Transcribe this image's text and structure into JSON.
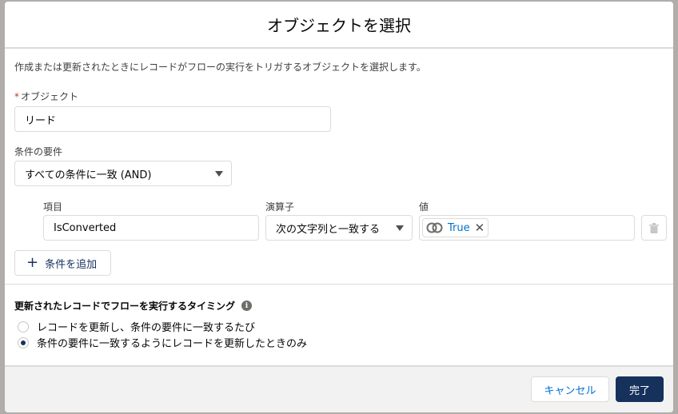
{
  "modal": {
    "title": "オブジェクトを選択",
    "description": "作成または更新されたときにレコードがフローの実行をトリガするオブジェクトを選択します。"
  },
  "object": {
    "required_mark": "*",
    "label": "オブジェクト",
    "value": "リード"
  },
  "conditions": {
    "label": "条件の要件",
    "selected": "すべての条件に一致 (AND)",
    "columns": {
      "field": "項目",
      "operator": "演算子",
      "value": "値"
    },
    "row": {
      "field": "IsConverted",
      "operator": "次の文字列と一致する",
      "value_pill": "True",
      "value_icon": "toggle-rings-icon"
    },
    "add_button": "条件を追加"
  },
  "timing": {
    "title": "更新されたレコードでフローを実行するタイミング",
    "info_icon": "info-icon",
    "options": [
      {
        "label": "レコードを更新し、条件の要件に一致するたび",
        "checked": false
      },
      {
        "label": "条件の要件に一致するようにレコードを更新したときのみ",
        "checked": true
      }
    ]
  },
  "footer": {
    "cancel": "キャンセル",
    "done": "完了"
  },
  "colors": {
    "brand_dark": "#16325c",
    "link": "#0070d2",
    "required": "#c23934",
    "border": "#dddbda",
    "overlay": "#b0adab"
  }
}
